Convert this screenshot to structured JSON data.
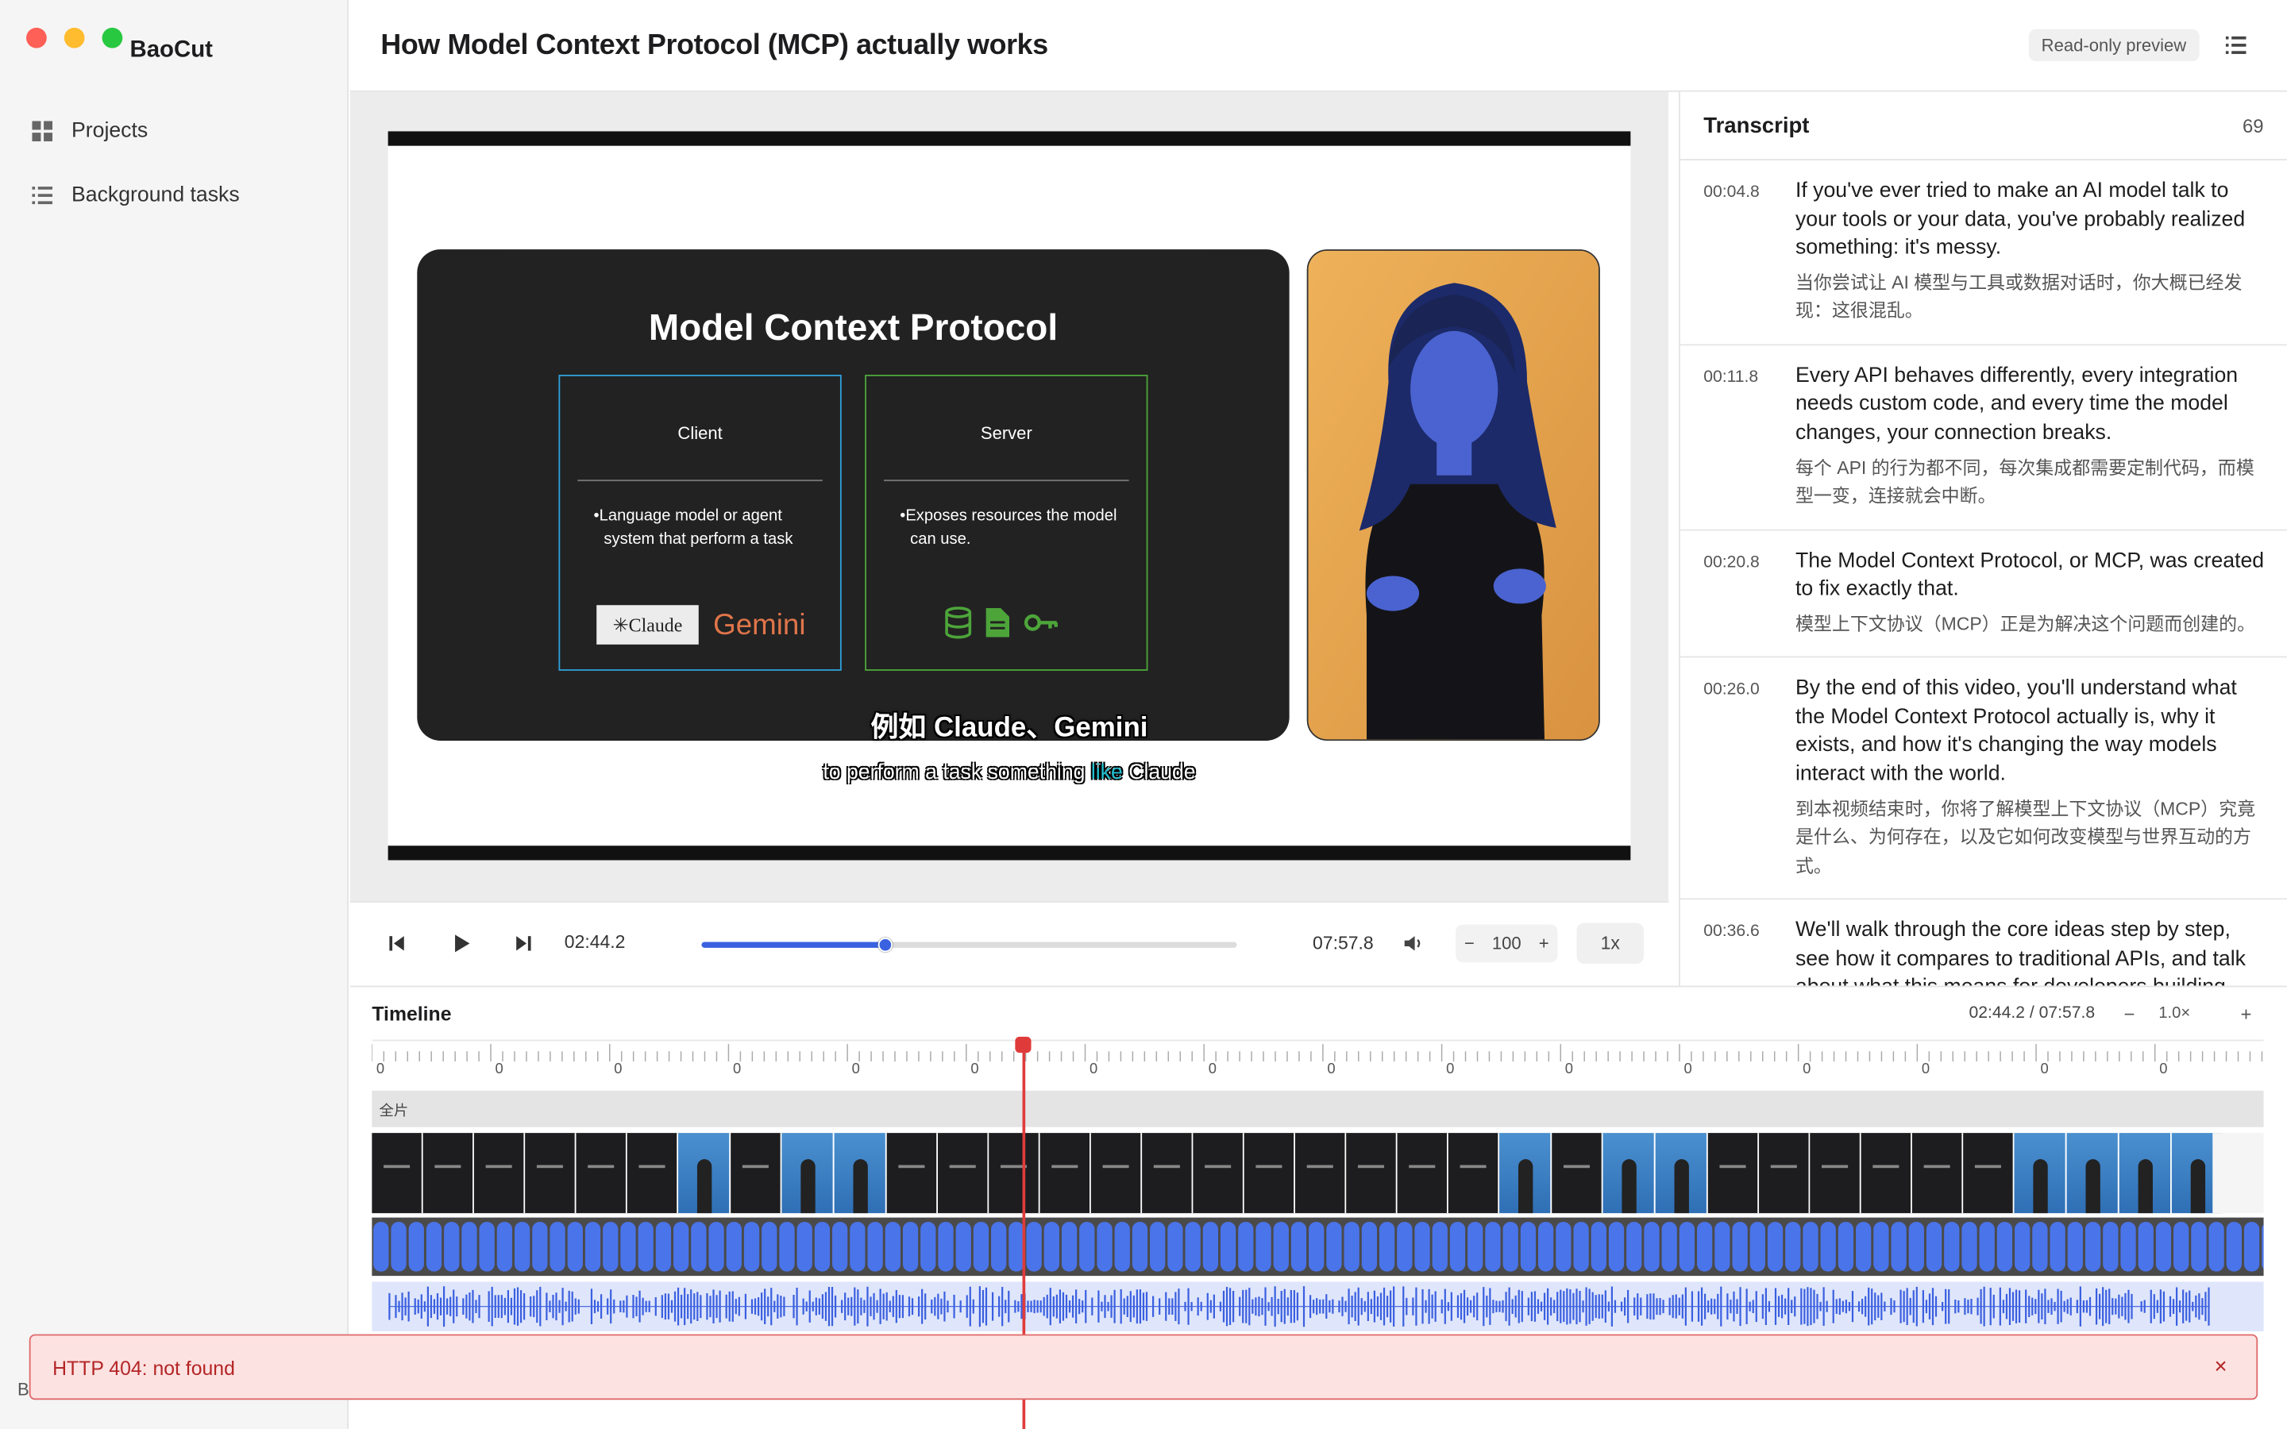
{
  "app": {
    "name": "BaoCut"
  },
  "sidebar": {
    "items": [
      {
        "label": "Projects",
        "icon": "grid-icon"
      },
      {
        "label": "Background tasks",
        "icon": "list-icon"
      }
    ],
    "footer_fragment": "B"
  },
  "header": {
    "title": "How Model Context Protocol (MCP) actually works",
    "badge": "Read-only preview"
  },
  "video": {
    "slide_title": "Model Context Protocol",
    "client": {
      "title": "Client",
      "text": "•Language model or agent system that perform a task",
      "logos": [
        "✳Claude",
        "Gemini"
      ]
    },
    "server": {
      "title": "Server",
      "text": "•Exposes resources the model can use."
    },
    "subtitle_zh": "例如 Claude、Gemini",
    "subtitle_en_before": "to perform a task something ",
    "subtitle_en_highlight": "like",
    "subtitle_en_after": " Claude"
  },
  "transport": {
    "current": "02:44.2",
    "duration": "07:57.8",
    "progress": 0.343,
    "volume_minus": "−",
    "volume": "100",
    "volume_plus": "+",
    "speed": "1x"
  },
  "transcript": {
    "title": "Transcript",
    "count": "69",
    "items": [
      {
        "time": "00:04.8",
        "en": "If you've ever tried to make an AI model talk to your tools or your data, you've probably realized something: it's messy.",
        "zh": "当你尝试让 AI 模型与工具或数据对话时，你大概已经发现：这很混乱。"
      },
      {
        "time": "00:11.8",
        "en": "Every API behaves differently, every integration needs custom code, and every time the model changes, your connection breaks.",
        "zh": "每个 API 的行为都不同，每次集成都需要定制代码，而模型一变，连接就会中断。"
      },
      {
        "time": "00:20.8",
        "en": "The Model Context Protocol, or MCP, was created to fix exactly that.",
        "zh": "模型上下文协议（MCP）正是为解决这个问题而创建的。"
      },
      {
        "time": "00:26.0",
        "en": "By the end of this video, you'll understand what the Model Context Protocol actually is, why it exists, and how it's changing the way models interact with the world.",
        "zh": "到本视频结束时，你将了解模型上下文协议（MCP）究竟是什么、为何存在，以及它如何改变模型与世界互动的方式。"
      },
      {
        "time": "00:36.6",
        "en": "We'll walk through the core ideas step by step, see how it compares to traditional APIs, and talk about what this means for developers building",
        "zh": ""
      }
    ]
  },
  "timeline": {
    "title": "Timeline",
    "time": "02:44.2 / 07:57.8",
    "zoom_minus": "−",
    "zoom": "1.0×",
    "zoom_plus": "+",
    "ruler_label": "0",
    "clip_label": "全片",
    "playhead_fraction": 0.343
  },
  "error": {
    "text": "HTTP 404: not found",
    "close": "×"
  },
  "colors": {
    "accent": "#3a62e0",
    "playhead": "#e03b3b",
    "error_bg": "#fde2e2",
    "error_text": "#b42525"
  }
}
